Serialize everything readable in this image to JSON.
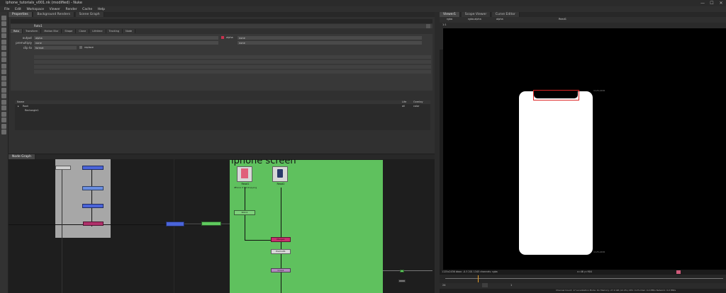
{
  "window": {
    "title": "iphone_tutorials_v001.nk (modified) - Nuke",
    "close": "✕",
    "min": "—",
    "max": "☐"
  },
  "menu": [
    "File",
    "Edit",
    "Workspace",
    "Viewer",
    "Render",
    "Cache",
    "Help"
  ],
  "properties": {
    "tabs": [
      "Properties",
      "Background Renders",
      "Scene Graph"
    ],
    "node_name": "Roto1",
    "subtabs": [
      "Roto",
      "Transform",
      "Motion Blur",
      "Shape",
      "Clone",
      "Lifetime",
      "Tracking",
      "Node"
    ],
    "fields": {
      "output_label": "output",
      "output_value": "alpha",
      "premultiply_label": "premultiply",
      "premultiply_value": "none",
      "clip_to_label": "clip to",
      "clip_to_value": "format",
      "replace_label": "replace",
      "alpha_label": "alpha",
      "none_label": "none"
    },
    "tree": {
      "header": [
        "Name",
        "Life",
        "Overlay"
      ],
      "items": [
        {
          "name": "Root",
          "life": "all",
          "overlay": "color"
        },
        {
          "name": "Rectangle1",
          "life": "",
          "overlay": ""
        }
      ]
    }
  },
  "node_graph": {
    "tab": "Node Graph",
    "backdrop_label": "iphone screen",
    "nodes": {
      "read1": "Read1",
      "read1_sub": "iPhone X Mockup.png",
      "read2": "Read2",
      "roto1": "Roto1",
      "merge": "Merge1",
      "premult": "Premult1",
      "crop": "Crop1"
    }
  },
  "viewer": {
    "tabs": [
      "Viewer1",
      "Scope Viewer",
      "Curve Editor"
    ],
    "channel_a": "rgba",
    "channel_b": "rgba.alpha",
    "channel_c": "alpha",
    "input_a": "Read1",
    "zoom": "1:1",
    "corner_tr": "1125,2436",
    "corner_bl": "1125,2436",
    "status_left": "1125x2436 bbox: -0.5 201 1345 channels: rgba",
    "status_mid": "x=46 y=904",
    "frame": "1",
    "fps": "24"
  },
  "statusbar": {
    "text": "Channel Count: 17 Localization Mode: On Memory: 27.0 GB (12.4%) CPU: 0.2% Disk: 0.0 MB/s Network: 0.0 MB/s"
  },
  "colors": {
    "graph_bg": "#1e1e1e",
    "backdrop_gray": "#a7a7a7",
    "backdrop_green": "#5fc15e",
    "merge": "#c8326e",
    "blue_node": "#4a64d9",
    "green_node": "#5fca5e"
  }
}
